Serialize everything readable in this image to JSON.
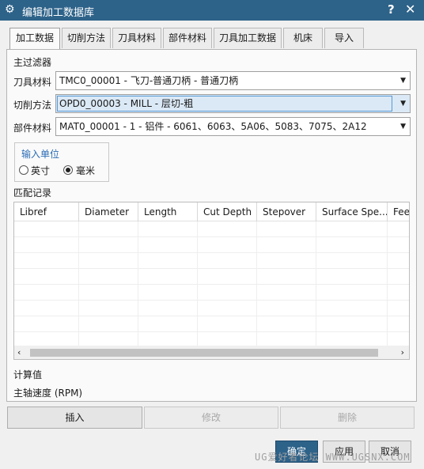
{
  "window": {
    "title": "编辑加工数据库",
    "help": "?",
    "close": "✕"
  },
  "tabs": [
    "加工数据",
    "切削方法",
    "刀具材料",
    "部件材料",
    "刀具加工数据",
    "机床",
    "导入"
  ],
  "filter": {
    "heading": "主过滤器",
    "tool_material": {
      "label": "刀具材料",
      "value": "TMC0_00001 - 飞刀-普通刀柄 - 普通刀柄"
    },
    "cut_method": {
      "label": "切削方法",
      "value": "OPD0_00003 - MILL - 层切-粗"
    },
    "part_material": {
      "label": "部件材料",
      "value": "MAT0_00001 - 1 - 铝件 - 6061、6063、5A06、5083、7075、2A12"
    }
  },
  "units": {
    "title": "输入单位",
    "inch": "英寸",
    "mm": "毫米",
    "selected": "mm"
  },
  "records": {
    "heading": "匹配记录",
    "columns": [
      "Libref",
      "Diameter",
      "Length",
      "Cut Depth",
      "Stepover",
      "Surface Spe...",
      "Feed"
    ]
  },
  "calc": {
    "heading": "计算值",
    "spindle": "主轴速度 (RPM)"
  },
  "actions": {
    "insert": "插入",
    "modify": "修改",
    "delete": "删除"
  },
  "footer": {
    "ok": "确定",
    "apply": "应用",
    "cancel": "取消"
  },
  "watermark": "UG爱好者论坛 WWW.UGSNX.COM"
}
